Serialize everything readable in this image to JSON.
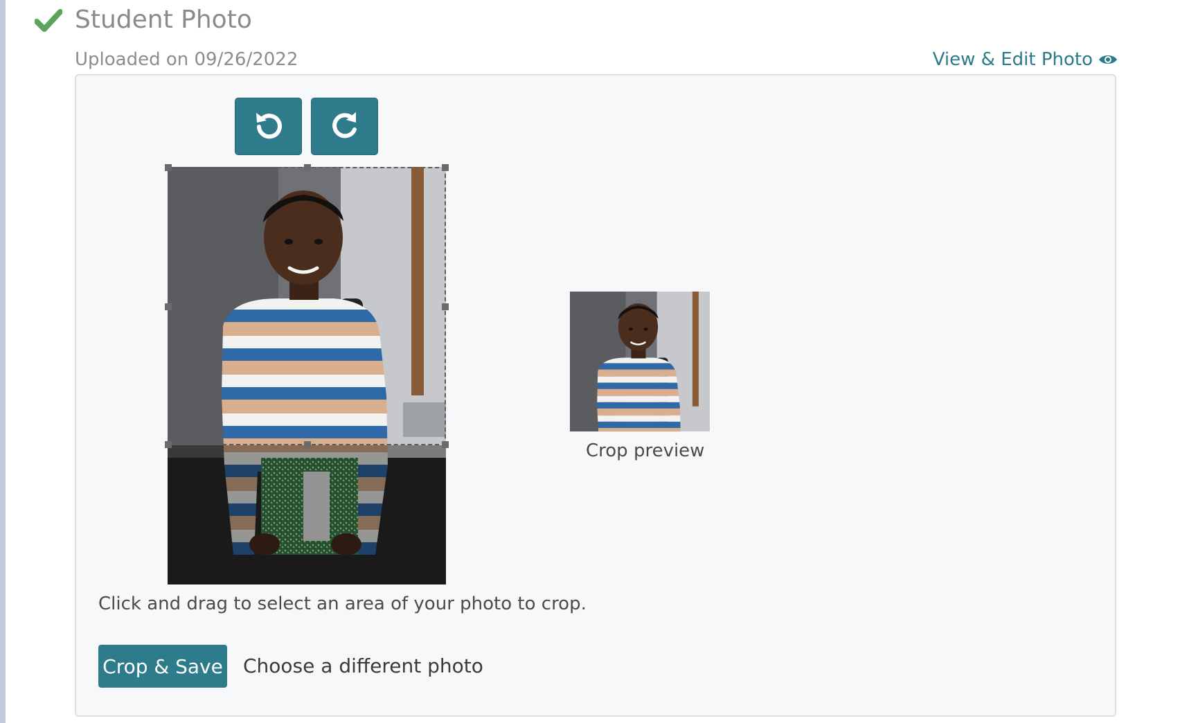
{
  "section": {
    "title": "Student Photo",
    "uploaded_text": "Uploaded on 09/26/2022",
    "view_edit_label": "View & Edit Photo",
    "status_icon": "check-icon",
    "status_color": "#5aa55a"
  },
  "toolbar": {
    "rotate_left_icon": "rotate-left-icon",
    "rotate_right_icon": "rotate-right-icon"
  },
  "cropper": {
    "preview_label": "Crop preview",
    "instructions": "Click and drag to select an area of your photo to crop."
  },
  "actions": {
    "crop_save_label": "Crop & Save",
    "choose_different_label": "Choose a different photo"
  },
  "colors": {
    "accent": "#2e7b8c",
    "link": "#2a7a8c",
    "check": "#5aa55a"
  }
}
